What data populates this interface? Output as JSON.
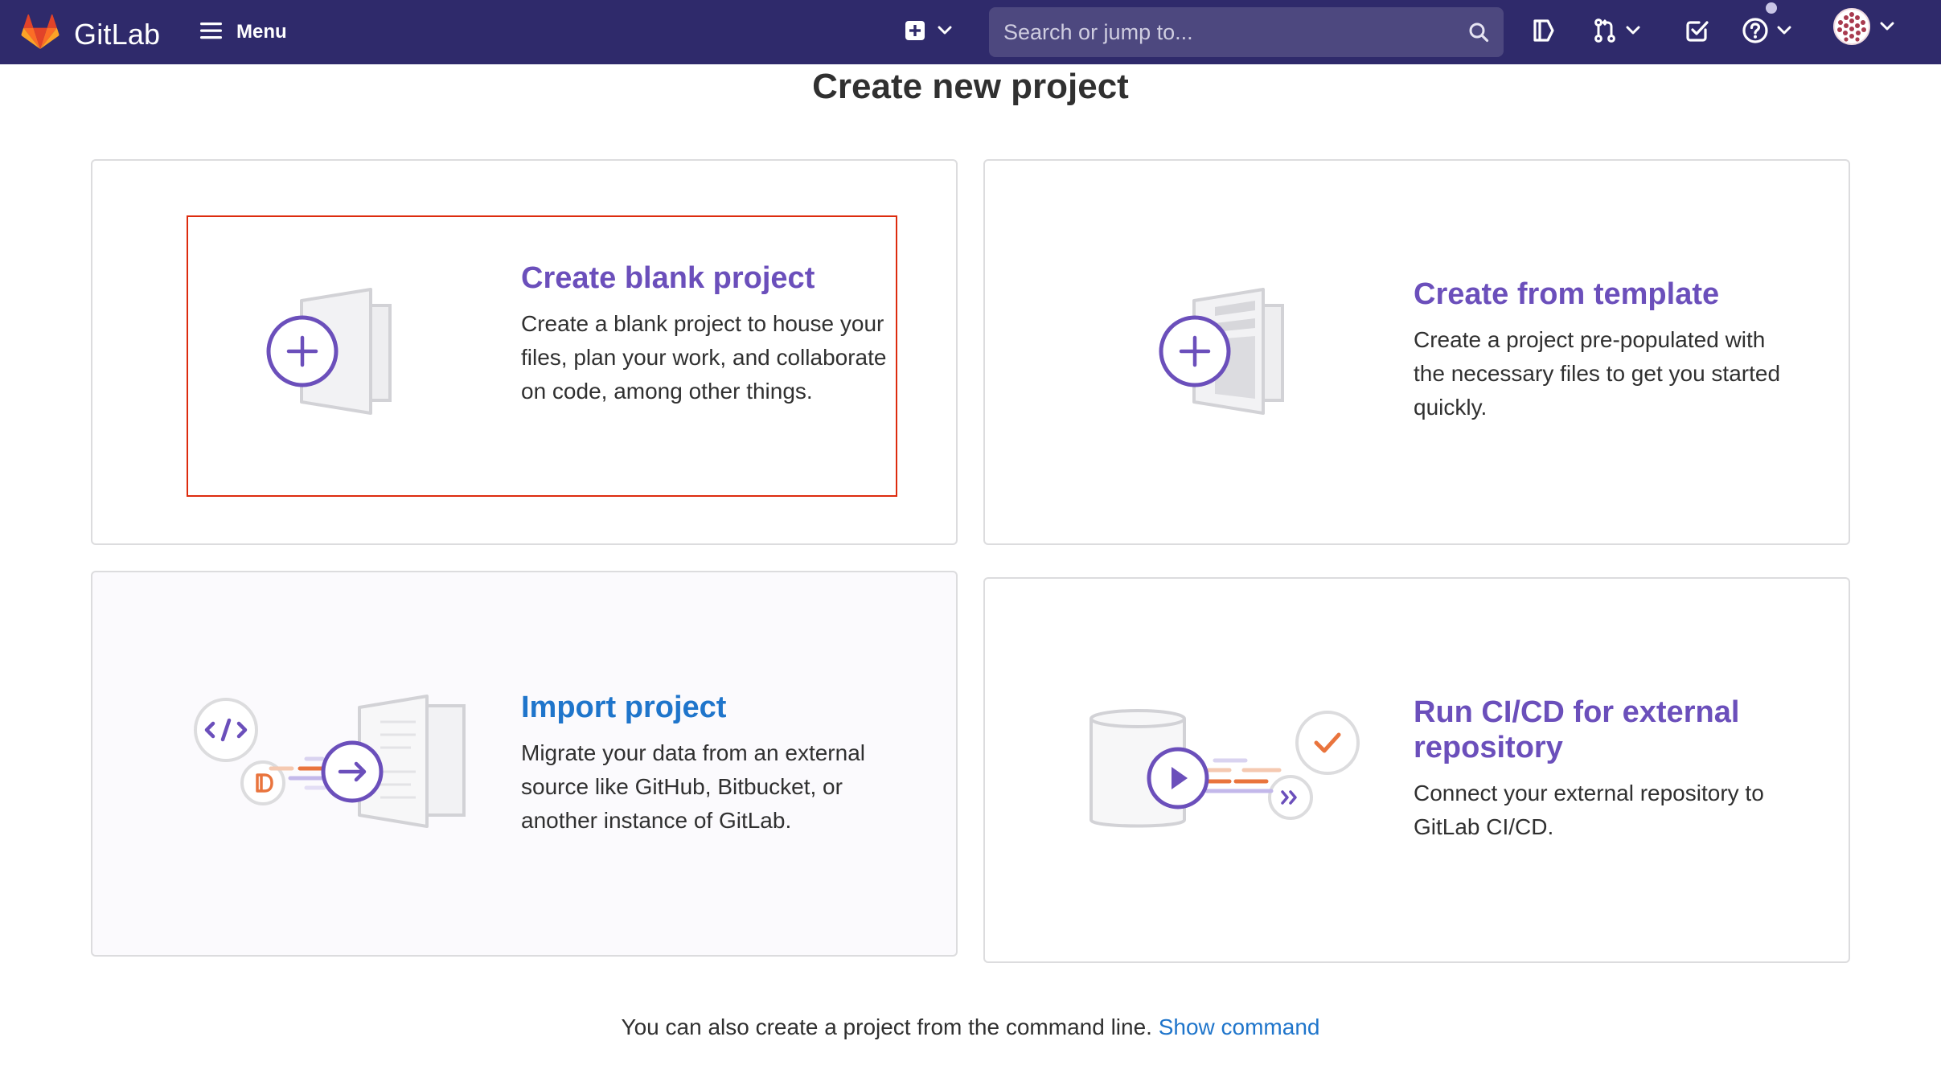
{
  "header": {
    "brand": "GitLab",
    "menu_label": "Menu",
    "search_placeholder": "Search or jump to..."
  },
  "page": {
    "title": "Create new project"
  },
  "cards": [
    {
      "title": "Create blank project",
      "description": "Create a blank project to house your files, plan your work, and collaborate on code, among other things."
    },
    {
      "title": "Create from template",
      "description": "Create a project pre-populated with the necessary files to get you started quickly."
    },
    {
      "title": "Import project",
      "description": "Migrate your data from an external source like GitHub, Bitbucket, or another instance of GitLab."
    },
    {
      "title": "Run CI/CD for external repository",
      "description": "Connect your external repository to GitLab CI/CD."
    }
  ],
  "footer": {
    "text": "You can also create a project from the command line.",
    "link": "Show command"
  },
  "colors": {
    "topbar": "#2f2a6b",
    "purple": "#6b4fbb",
    "blue": "#1f75cb",
    "orange": "#e24329",
    "focus": "#dd2b0e"
  },
  "icons": [
    "gitlab-logo-icon",
    "hamburger-icon",
    "plus-square-icon",
    "chevron-down-icon",
    "search-icon",
    "issues-icon",
    "merge-request-icon",
    "todo-icon",
    "help-icon",
    "avatar"
  ]
}
